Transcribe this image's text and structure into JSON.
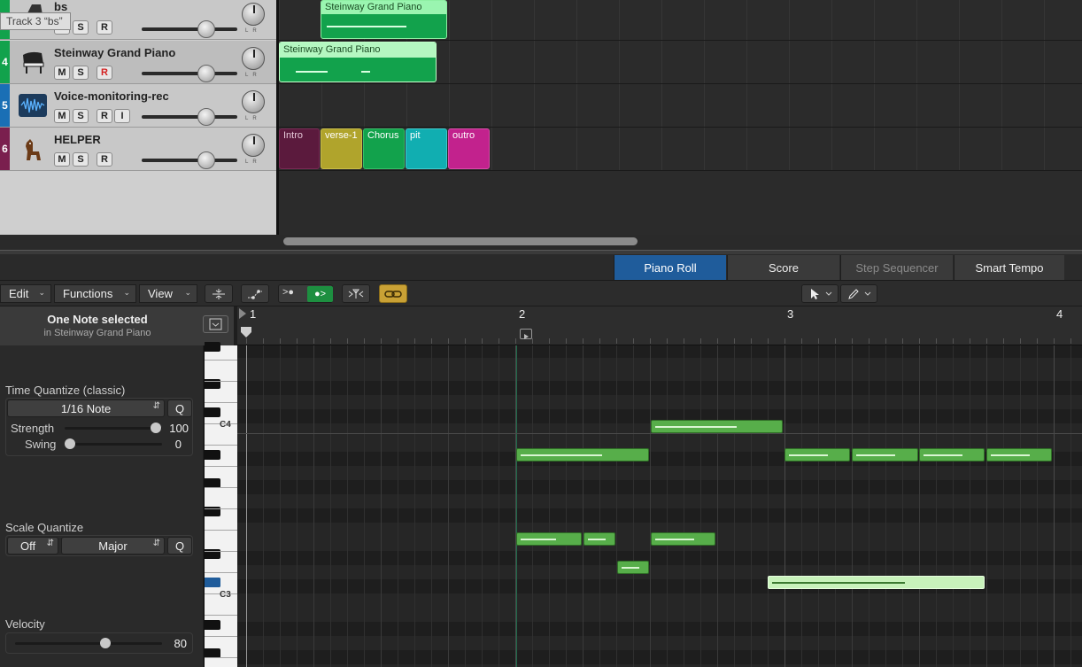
{
  "tooltip": "Track 3 “bs”",
  "tracks": [
    {
      "num": "",
      "name": "bs",
      "buttons": [
        "M",
        "S",
        "R"
      ],
      "color": "#12a24c"
    },
    {
      "num": "4",
      "name": "Steinway Grand Piano",
      "buttons": [
        "M",
        "S",
        "R"
      ],
      "color": "#12a24c"
    },
    {
      "num": "5",
      "name": "Voice-monitoring-rec",
      "buttons": [
        "M",
        "S",
        "R",
        "I"
      ],
      "color": "#1a6fb5"
    },
    {
      "num": "6",
      "name": "HELPER",
      "buttons": [
        "M",
        "S",
        "R"
      ],
      "color": "#7a1f4e"
    }
  ],
  "regions": {
    "r1": "Steinway Grand Piano",
    "r2": "Steinway Grand Piano",
    "intro": "Intro",
    "verse": "verse-1",
    "chorus": "Chorus",
    "pit": "pit",
    "outro": "outro"
  },
  "tabs": [
    "Piano Roll",
    "Score",
    "Step Sequencer",
    "Smart Tempo"
  ],
  "menus": {
    "edit": "Edit",
    "functions": "Functions",
    "view": "View"
  },
  "inspector": {
    "selection_title": "One Note selected",
    "selection_sub": "in Steinway Grand Piano",
    "time_quantize_label": "Time Quantize (classic)",
    "time_quantize_value": "1/16 Note",
    "q": "Q",
    "strength_label": "Strength",
    "strength_value": "100",
    "swing_label": "Swing",
    "swing_value": "0",
    "scale_quantize_label": "Scale Quantize",
    "scale_off": "Off",
    "scale_mode": "Major",
    "velocity_label": "Velocity",
    "velocity_value": "80"
  },
  "keyboard": {
    "c4": "C4",
    "c3": "C3"
  },
  "ruler": {
    "bar1": "1",
    "bar2": "2",
    "bar3": "3",
    "bar4": "4"
  },
  "colors": {
    "accent": "#1f5c9b",
    "note": "#57ae4a",
    "note_selected": "#c8f2bb"
  }
}
